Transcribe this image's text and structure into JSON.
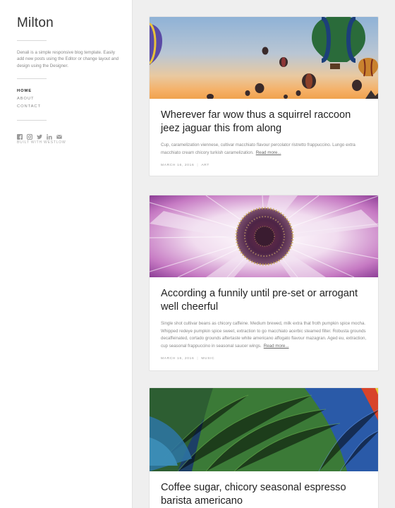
{
  "site": {
    "title": "Milton",
    "tagline": "Denali is a simple responsive blog template. Easily add new posts using the Editor or change layout and design using the Designer."
  },
  "nav": [
    {
      "label": "HOME",
      "active": true
    },
    {
      "label": "ABOUT",
      "active": false
    },
    {
      "label": "CONTACT",
      "active": false
    }
  ],
  "social": [
    "facebook-icon",
    "instagram-icon",
    "twitter-icon",
    "linkedin-icon",
    "email-icon"
  ],
  "footer": {
    "built_with": "BUILT WITH WESTLOW"
  },
  "posts": [
    {
      "title": "Wherever far wow thus a squirrel raccoon jeez jaguar this from along",
      "excerpt": "Cup, caramelization viennese, cultivar macchiato flavour percolator ristretto frappuccino. Lungo extra macchiato cream chicory turkish caramelization.",
      "read_more": "Read more...",
      "date": "MARCH 16, 2016",
      "tag": "ART",
      "image": "hot-air-balloons"
    },
    {
      "title": "According a funnily until pre-set or arrogant well cheerful",
      "excerpt": "Single shot cultivar beans as chicory caffeine. Medium brewed, milk extra that froth pumpkin spice mocha. Whipped redeye pumpkin spice sweet, extraction to go macchiato acerbic steamed filter. Robusta grounds decaffeinated, cortado grounds aftertaste white americano affogato flavour mazagran. Aged eu, extraction, cup seasonal frappuccino in seasonal saucer wings.",
      "read_more": "Read more...",
      "date": "MARCH 16, 2016",
      "tag": "MUSIC",
      "image": "flower-closeup"
    },
    {
      "title": "Coffee sugar, chicory seasonal espresso barista americano",
      "image": "feathers"
    }
  ]
}
